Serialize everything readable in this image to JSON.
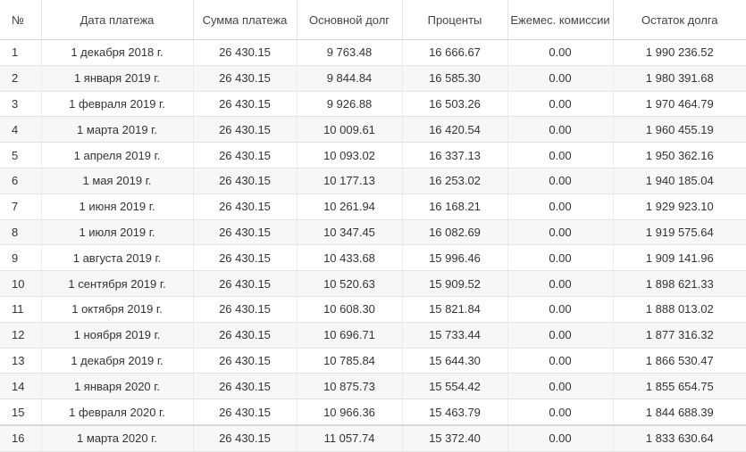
{
  "table": {
    "headers": [
      "№",
      "Дата платежа",
      "Сумма платежа",
      "Основной долг",
      "Проценты",
      "Ежемес. комиссии",
      "Остаток долга"
    ],
    "rows": [
      [
        "1",
        "1 декабря 2018 г.",
        "26 430.15",
        "9 763.48",
        "16 666.67",
        "0.00",
        "1 990 236.52"
      ],
      [
        "2",
        "1 января 2019 г.",
        "26 430.15",
        "9 844.84",
        "16 585.30",
        "0.00",
        "1 980 391.68"
      ],
      [
        "3",
        "1 февраля 2019 г.",
        "26 430.15",
        "9 926.88",
        "16 503.26",
        "0.00",
        "1 970 464.79"
      ],
      [
        "4",
        "1 марта 2019 г.",
        "26 430.15",
        "10 009.61",
        "16 420.54",
        "0.00",
        "1 960 455.19"
      ],
      [
        "5",
        "1 апреля 2019 г.",
        "26 430.15",
        "10 093.02",
        "16 337.13",
        "0.00",
        "1 950 362.16"
      ],
      [
        "6",
        "1 мая 2019 г.",
        "26 430.15",
        "10 177.13",
        "16 253.02",
        "0.00",
        "1 940 185.04"
      ],
      [
        "7",
        "1 июня 2019 г.",
        "26 430.15",
        "10 261.94",
        "16 168.21",
        "0.00",
        "1 929 923.10"
      ],
      [
        "8",
        "1 июля 2019 г.",
        "26 430.15",
        "10 347.45",
        "16 082.69",
        "0.00",
        "1 919 575.64"
      ],
      [
        "9",
        "1 августа 2019 г.",
        "26 430.15",
        "10 433.68",
        "15 996.46",
        "0.00",
        "1 909 141.96"
      ],
      [
        "10",
        "1 сентября 2019 г.",
        "26 430.15",
        "10 520.63",
        "15 909.52",
        "0.00",
        "1 898 621.33"
      ],
      [
        "11",
        "1 октября 2019 г.",
        "26 430.15",
        "10 608.30",
        "15 821.84",
        "0.00",
        "1 888 013.02"
      ],
      [
        "12",
        "1 ноября 2019 г.",
        "26 430.15",
        "10 696.71",
        "15 733.44",
        "0.00",
        "1 877 316.32"
      ],
      [
        "13",
        "1 декабря 2019 г.",
        "26 430.15",
        "10 785.84",
        "15 644.30",
        "0.00",
        "1 866 530.47"
      ],
      [
        "14",
        "1 января 2020 г.",
        "26 430.15",
        "10 875.73",
        "15 554.42",
        "0.00",
        "1 855 654.75"
      ],
      [
        "15",
        "1 февраля 2020 г.",
        "26 430.15",
        "10 966.36",
        "15 463.79",
        "0.00",
        "1 844 688.39"
      ],
      [
        "16",
        "1 марта 2020 г.",
        "26 430.15",
        "11 057.74",
        "15 372.40",
        "0.00",
        "1 833 630.64"
      ]
    ]
  }
}
